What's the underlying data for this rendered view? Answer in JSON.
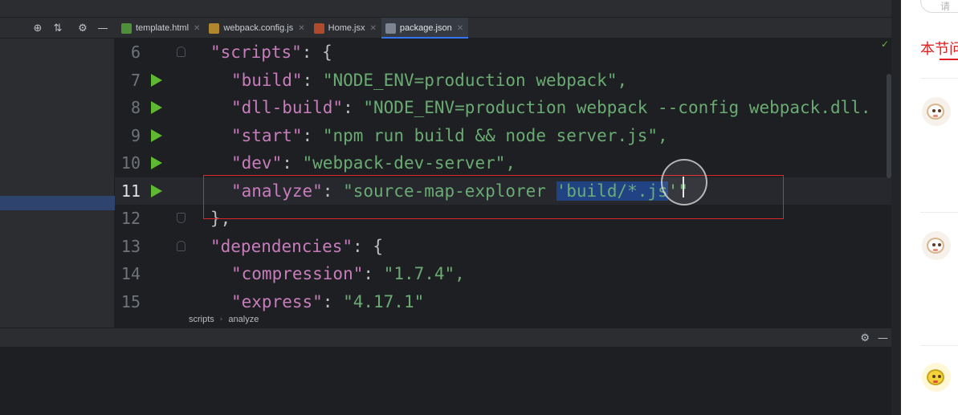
{
  "tool_icons": [
    "crosshair-icon",
    "collapse-icon",
    "gear-icon",
    "minimize-icon"
  ],
  "tabs": [
    {
      "label": "template.html",
      "icon": "html-file-icon",
      "active": false
    },
    {
      "label": "webpack.config.js",
      "icon": "js-file-icon",
      "active": false
    },
    {
      "label": "Home.jsx",
      "icon": "jsx-file-icon",
      "active": false
    },
    {
      "label": "package.json",
      "icon": "json-file-icon",
      "active": true
    }
  ],
  "editor": {
    "lines": [
      {
        "num": "6",
        "key": "\"scripts\"",
        "value": "{"
      },
      {
        "num": "7",
        "key": "\"build\"",
        "value": "\"NODE_ENV=production webpack\","
      },
      {
        "num": "8",
        "key": "\"dll-build\"",
        "value": "\"NODE_ENV=production webpack --config webpack.dll."
      },
      {
        "num": "9",
        "key": "\"start\"",
        "value": "\"npm run build && node server.js\","
      },
      {
        "num": "10",
        "key": "\"dev\"",
        "value": "\"webpack-dev-server\","
      },
      {
        "num": "11",
        "key": "\"analyze\"",
        "value_pre": "\"source-map-explorer ",
        "value_selected": "'build/*.js",
        "value_post": "'\""
      },
      {
        "num": "12",
        "text": "},"
      },
      {
        "num": "13",
        "key": "\"dependencies\"",
        "value": "{"
      },
      {
        "num": "14",
        "key": "\"compression\"",
        "value": "\"1.7.4\","
      },
      {
        "num": "15",
        "key": "\"express\"",
        "value": "\"4.17.1\""
      }
    ],
    "colon": ": ",
    "colors": {
      "key": "#c77dbb",
      "string": "#6aab73",
      "selection": "#214283",
      "annotation_box": "#e0252a",
      "run_icon": "#5fb832"
    }
  },
  "breadcrumb": [
    "scripts",
    "analyze"
  ],
  "right_panel": {
    "search_placeholder": "请",
    "section_title": "本节问",
    "accent": "#e02020"
  }
}
